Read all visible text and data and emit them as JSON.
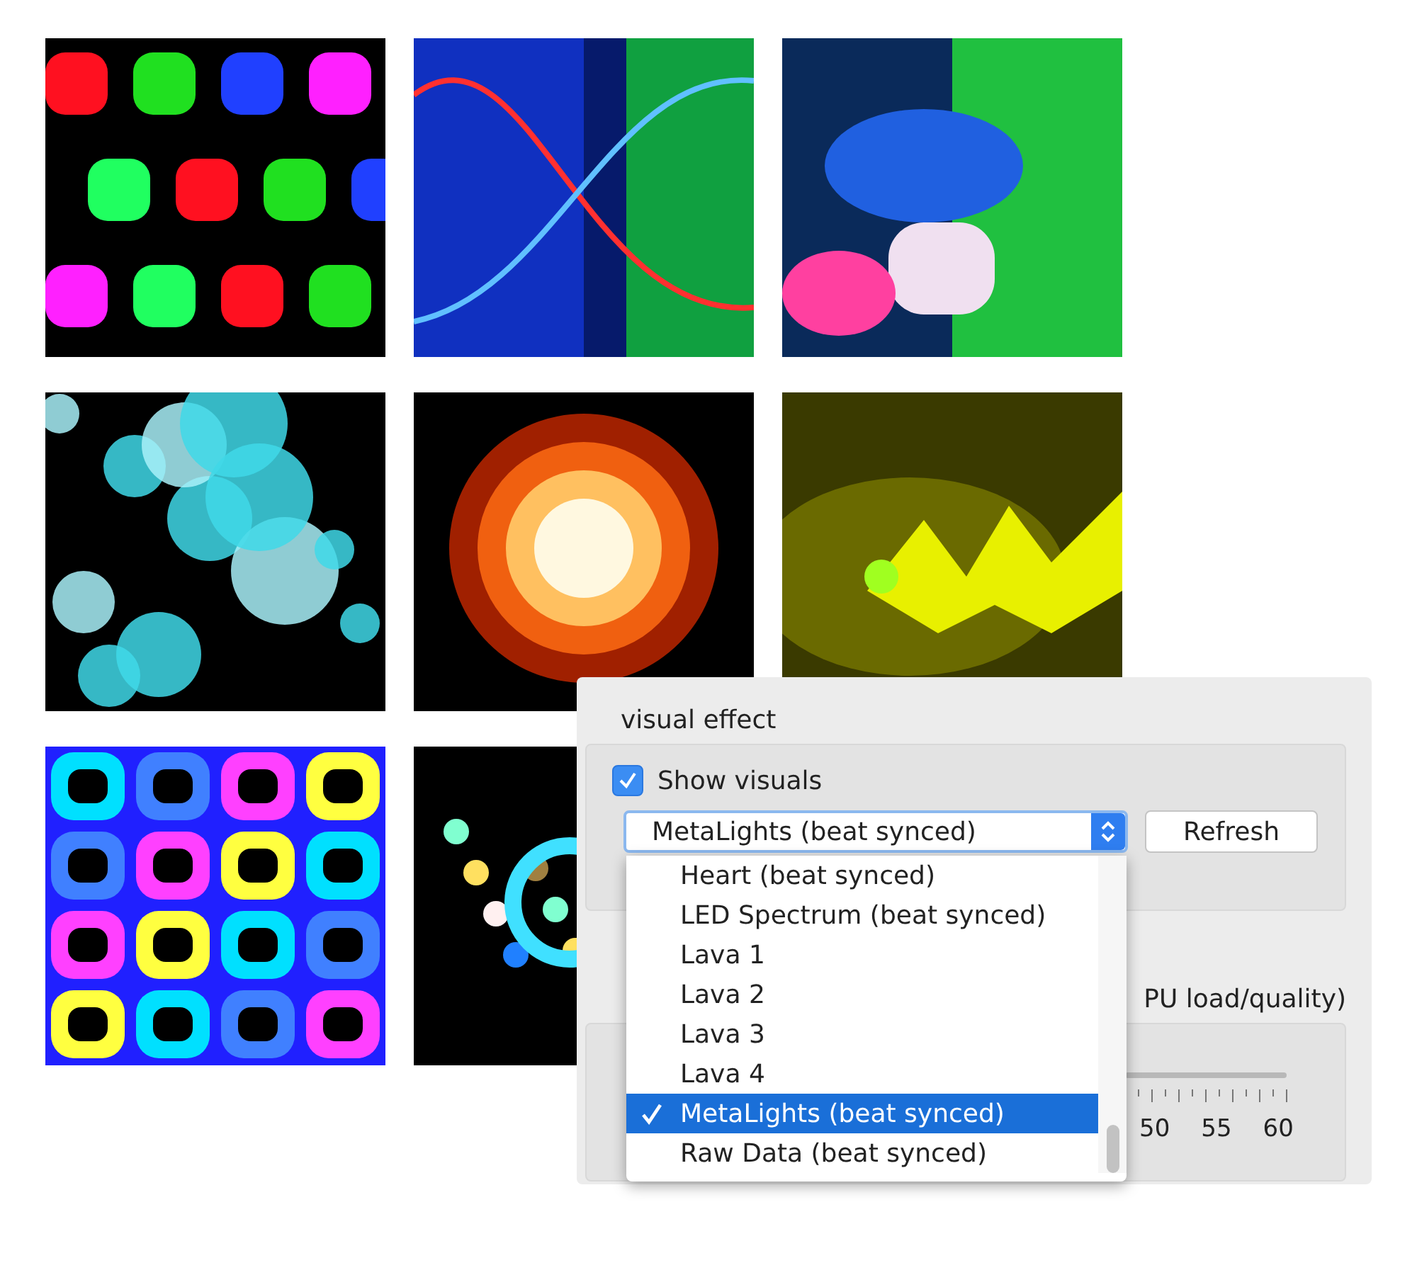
{
  "settings": {
    "section_title": "visual effect",
    "show_visuals": {
      "label": "Show visuals",
      "checked": true
    },
    "effect_select": {
      "value": "MetaLights (beat synced)",
      "expanded": true
    },
    "refresh_button": "Refresh",
    "effect_options": [
      {
        "label": "Heart (beat synced)",
        "selected": false
      },
      {
        "label": "LED Spectrum (beat synced)",
        "selected": false
      },
      {
        "label": "Lava 1",
        "selected": false
      },
      {
        "label": "Lava 2",
        "selected": false
      },
      {
        "label": "Lava 3",
        "selected": false
      },
      {
        "label": "Lava 4",
        "selected": false
      },
      {
        "label": "MetaLights (beat synced)",
        "selected": true
      },
      {
        "label": "Raw Data (beat synced)",
        "selected": false
      }
    ],
    "frame_rate_label": "PU load/quality)",
    "frame_rate_ticks": [
      "50",
      "55",
      "60"
    ]
  }
}
